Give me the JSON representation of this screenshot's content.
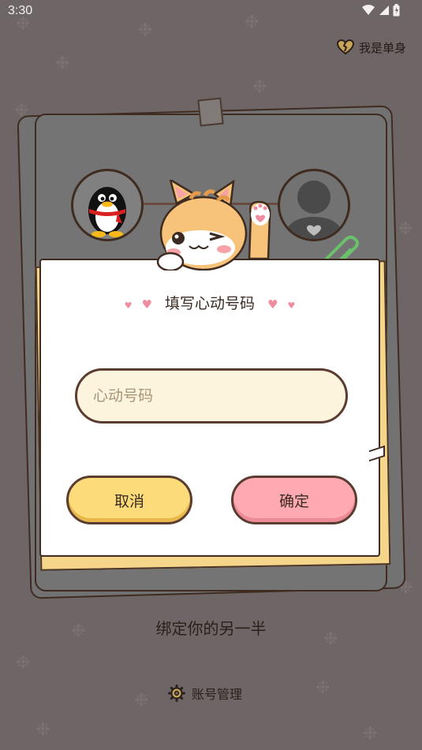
{
  "status_bar": {
    "time": "3:30"
  },
  "header": {
    "single_label": "我是单身"
  },
  "dialog": {
    "title": "填写心动号码",
    "input_value": "",
    "input_placeholder": "心动号码",
    "cancel_label": "取消",
    "confirm_label": "确定"
  },
  "bind_text": "绑定你的另一半",
  "footer": {
    "account_label": "账号管理"
  },
  "icons": {
    "wifi": "wifi-icon",
    "signal": "signal-icon",
    "battery": "battery-icon",
    "broken_heart": "broken-heart-icon",
    "gear": "gear-icon",
    "paperclip": "paperclip-icon",
    "paw": "paw-print-icon"
  },
  "colors": {
    "background": "#6e6666",
    "cancel_button": "#fcdc7a",
    "confirm_button": "#ffaab2",
    "input_fill": "#fdf4dd",
    "heart_pink": "#f08ca0"
  }
}
